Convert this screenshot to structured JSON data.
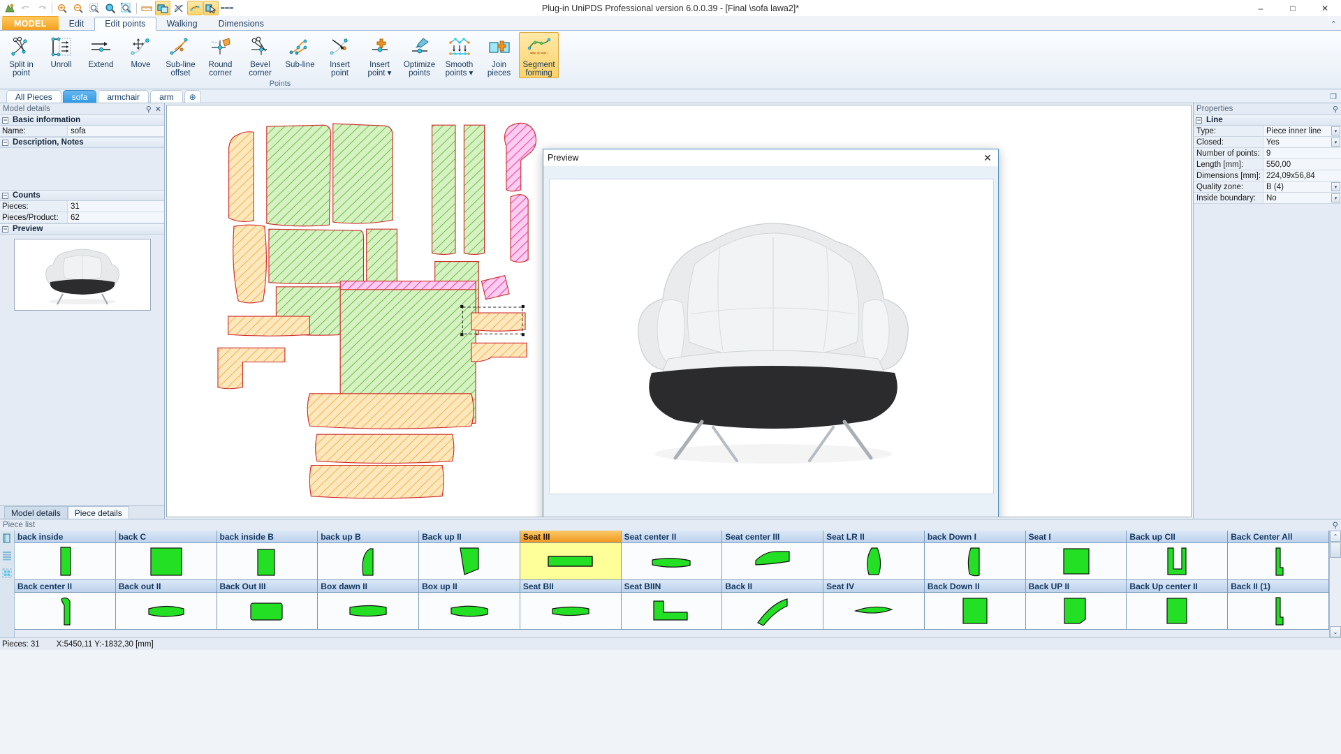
{
  "window": {
    "title": "Plug-in UniPDS Professional version 6.0.0.39 - [Final \\sofa lawa2]*",
    "minimize": "–",
    "maximize": "□",
    "close": "✕"
  },
  "quick_access": [
    {
      "name": "app-logo-icon",
      "label": "app-logo"
    },
    {
      "name": "undo-icon",
      "label": "Undo"
    },
    {
      "name": "redo-icon",
      "label": "Redo"
    },
    {
      "name": "zoom-in-icon",
      "label": "Zoom in"
    },
    {
      "name": "zoom-out-icon",
      "label": "Zoom out"
    },
    {
      "name": "zoom-window-icon",
      "label": "Zoom window"
    },
    {
      "name": "zoom-all-icon",
      "label": "Zoom all"
    },
    {
      "name": "zoom-selection-icon",
      "label": "Zoom selection"
    },
    {
      "name": "measure-icon",
      "label": "Measure"
    },
    {
      "name": "show-pieces-icon",
      "label": "Show pieces"
    },
    {
      "name": "hide-lines-icon",
      "label": "Hide lines"
    },
    {
      "name": "show-points-icon",
      "label": "Show points"
    },
    {
      "name": "select-mode-icon",
      "label": "Select mode"
    },
    {
      "name": "overflow-icon",
      "label": "More commands"
    }
  ],
  "ribbon": {
    "tabs": [
      {
        "label": "MODEL",
        "kind": "file"
      },
      {
        "label": "Edit",
        "kind": "normal"
      },
      {
        "label": "Edit points",
        "kind": "active"
      },
      {
        "label": "Walking",
        "kind": "normal"
      },
      {
        "label": "Dimensions",
        "kind": "normal"
      }
    ],
    "collapse_icon": "⌃",
    "group_label": "Points",
    "buttons": [
      {
        "label": "Split in\npoint",
        "icon": "split-in-point-icon",
        "state": "normal"
      },
      {
        "label": "Unroll",
        "icon": "unroll-icon",
        "state": "normal"
      },
      {
        "label": "Extend",
        "icon": "extend-icon",
        "state": "normal"
      },
      {
        "label": "Move",
        "icon": "move-icon",
        "state": "normal"
      },
      {
        "label": "Sub-line\noffset",
        "icon": "sub-line-offset-icon",
        "state": "normal"
      },
      {
        "label": "Round\ncorner",
        "icon": "round-corner-icon",
        "state": "normal"
      },
      {
        "label": "Bevel\ncorner",
        "icon": "bevel-corner-icon",
        "state": "normal"
      },
      {
        "label": "Sub-line",
        "icon": "sub-line-icon",
        "state": "normal"
      },
      {
        "label": "Insert\npoint",
        "icon": "insert-point-icon",
        "state": "normal"
      },
      {
        "label": "Insert\npoint ▾",
        "icon": "insert-point-menu-icon",
        "state": "normal"
      },
      {
        "label": "Optimize\npoints",
        "icon": "optimize-points-icon",
        "state": "normal"
      },
      {
        "label": "Smooth\npoints ▾",
        "icon": "smooth-points-icon",
        "state": "normal"
      },
      {
        "label": "Join\npieces",
        "icon": "join-pieces-icon",
        "state": "normal"
      },
      {
        "label": "Segment\nforming",
        "icon": "segment-forming-icon",
        "state": "active"
      }
    ]
  },
  "piece_tabs": {
    "items": [
      {
        "label": "All Pieces",
        "selected": false
      },
      {
        "label": "sofa",
        "selected": true
      },
      {
        "label": "armchair",
        "selected": false
      },
      {
        "label": "arm",
        "selected": false
      },
      {
        "label": "⊕",
        "selected": false
      }
    ],
    "right_icon": "restore-panel-icon"
  },
  "left_panel": {
    "title": "Model details",
    "pin_icon": "pin-icon",
    "close_icon": "close-icon",
    "groups": {
      "basic_information": "Basic information",
      "description_notes": "Description, Notes",
      "counts": "Counts",
      "preview": "Preview"
    },
    "fields": [
      {
        "key": "Name:",
        "value": "sofa"
      }
    ],
    "counts": [
      {
        "key": "Pieces:",
        "value": "31"
      },
      {
        "key": "Pieces/Product:",
        "value": "62"
      }
    ],
    "bottom_tabs": [
      {
        "label": "Model details",
        "selected": true
      },
      {
        "label": "Piece details",
        "selected": false
      }
    ]
  },
  "right_panel": {
    "title": "Properties",
    "pin_icon": "pin-icon",
    "group": "Line",
    "rows": [
      {
        "key": "Type:",
        "value": "Piece inner line",
        "dropdown": true
      },
      {
        "key": "Closed:",
        "value": "Yes",
        "dropdown": true
      },
      {
        "key": "Number of points:",
        "value": "9",
        "dropdown": false
      },
      {
        "key": "Length [mm]:",
        "value": "550,00",
        "dropdown": false
      },
      {
        "key": "Dimensions [mm]:",
        "value": "224,09x56,84",
        "dropdown": false
      },
      {
        "key": "Quality zone:",
        "value": "B (4)",
        "dropdown": true
      },
      {
        "key": "Inside boundary:",
        "value": "No",
        "dropdown": true
      }
    ]
  },
  "preview_dialog": {
    "title": "Preview",
    "close": "✕"
  },
  "piece_list": {
    "title": "Piece list",
    "sidebar_icons": [
      "pieces-view-icon",
      "list-view-icon",
      "grid-view-icon"
    ],
    "scroll_up": "⌃",
    "scroll_down": "⌄",
    "row1": [
      {
        "label": "back inside",
        "shape": "tall-rect",
        "selected": false
      },
      {
        "label": "back C",
        "shape": "rect",
        "selected": false
      },
      {
        "label": "back inside B",
        "shape": "rect-notch",
        "selected": false
      },
      {
        "label": "back up B",
        "shape": "dome",
        "selected": false
      },
      {
        "label": "Back up II",
        "shape": "trapezoid",
        "selected": false
      },
      {
        "label": "Seat III",
        "shape": "wide-bar",
        "selected": true
      },
      {
        "label": "Seat center II",
        "shape": "flat-bar",
        "selected": false
      },
      {
        "label": "Seat center III",
        "shape": "wedge",
        "selected": false
      },
      {
        "label": "Seat LR II",
        "shape": "leaf",
        "selected": false
      },
      {
        "label": "back Down I",
        "shape": "curve-tall",
        "selected": false
      },
      {
        "label": "Seat I",
        "shape": "square",
        "selected": false
      },
      {
        "label": "Back up CII",
        "shape": "u-shape",
        "selected": false
      },
      {
        "label": "Back Center All",
        "shape": "thin-l",
        "selected": false
      }
    ],
    "row2": [
      {
        "label": "Back center II",
        "shape": "hook",
        "selected": false
      },
      {
        "label": "Back out II",
        "shape": "flat-curve",
        "selected": false
      },
      {
        "label": "Back Out III",
        "shape": "round-rect",
        "selected": false
      },
      {
        "label": "Box dawn II",
        "shape": "slab",
        "selected": false
      },
      {
        "label": "Box up II",
        "shape": "wave",
        "selected": false
      },
      {
        "label": "Seat BII",
        "shape": "flat-bar",
        "selected": false
      },
      {
        "label": "Seat BIIN",
        "shape": "l-shape",
        "selected": false
      },
      {
        "label": "Back II",
        "shape": "diagonal",
        "selected": false
      },
      {
        "label": "Seat IV",
        "shape": "lens",
        "selected": false
      },
      {
        "label": "Back Down II",
        "shape": "square",
        "selected": false
      },
      {
        "label": "Back UP II",
        "shape": "square-notch",
        "selected": false
      },
      {
        "label": "Back Up center II",
        "shape": "rect",
        "selected": false
      },
      {
        "label": "Back II (1)",
        "shape": "thin-l",
        "selected": false
      }
    ]
  },
  "status_bar": {
    "pieces": "Pieces: 31",
    "coords": "X:5450,11  Y:-1832,30 [mm]"
  }
}
